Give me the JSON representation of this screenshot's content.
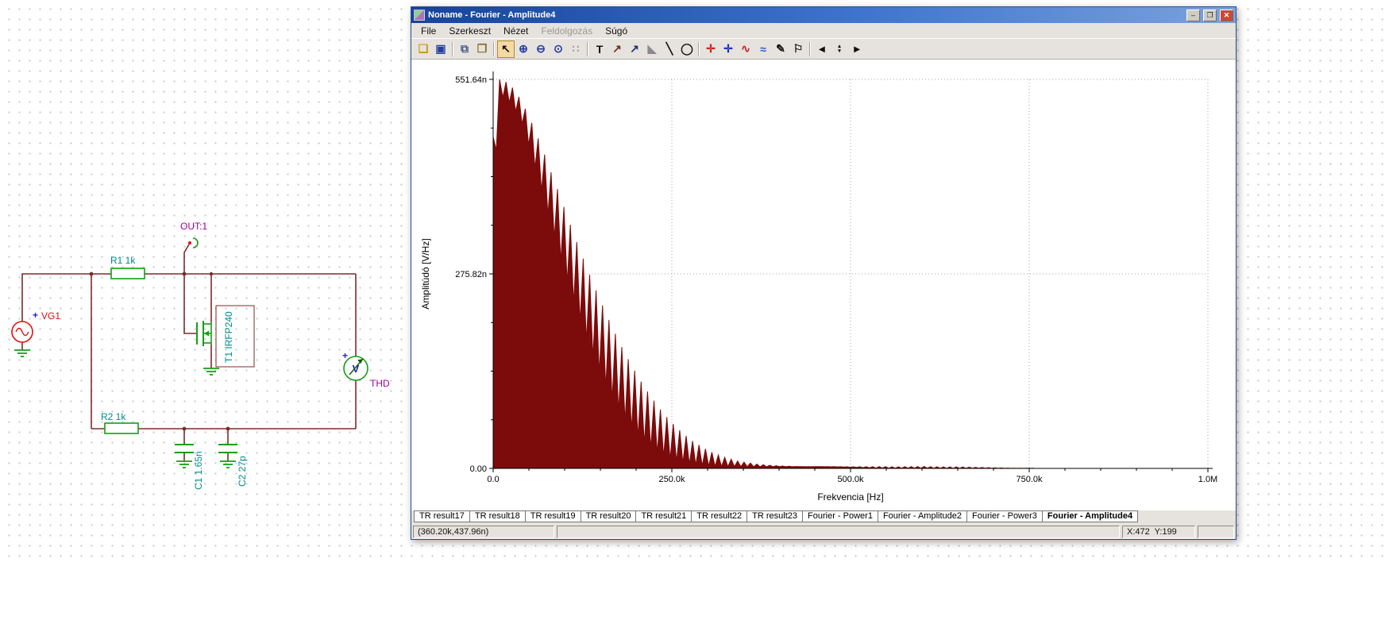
{
  "schematic": {
    "source_label": "VG1",
    "source_plus": "+",
    "r1_label": "R1 1k",
    "r2_label": "R2 1k",
    "out_label": "OUT:1",
    "mosfet_label": "T1 IRFP240",
    "c1_label": "C1 1.65n",
    "c2_label": "C2 27p",
    "meter_label": "THD",
    "meter_symbol": "V",
    "meter_plus": "+",
    "colors": {
      "wire": "#7b2b2b",
      "component": "#12a012",
      "value_label": "#008b8b",
      "net_label": "#a000a0",
      "source": "#e01010",
      "meter_text": "#2424c8"
    }
  },
  "window": {
    "title": "Noname - Fourier - Amplitude4",
    "controls": {
      "minimize": "‒",
      "restore": "❐",
      "close": "✕"
    }
  },
  "menu": {
    "items": [
      {
        "label": "File",
        "enabled": true
      },
      {
        "label": "Szerkeszt",
        "enabled": true
      },
      {
        "label": "Nézet",
        "enabled": true
      },
      {
        "label": "Feldolgozás",
        "enabled": false
      },
      {
        "label": "Súgó",
        "enabled": true
      }
    ]
  },
  "toolbar": {
    "icons": [
      {
        "name": "open-icon",
        "glyph": "❑",
        "color": "#c79810"
      },
      {
        "name": "save-icon",
        "glyph": "▣",
        "color": "#24409c"
      },
      {
        "sep": true
      },
      {
        "name": "copy-icon",
        "glyph": "⧉",
        "color": "#445a8c"
      },
      {
        "name": "paste-icon",
        "glyph": "❒",
        "color": "#8c6a2a"
      },
      {
        "sep": true
      },
      {
        "name": "select-tool-icon",
        "glyph": "↖",
        "color": "#101010",
        "active": true
      },
      {
        "name": "zoom-in-icon",
        "glyph": "⊕",
        "color": "#283ca0"
      },
      {
        "name": "zoom-out-icon",
        "glyph": "⊖",
        "color": "#283ca0"
      },
      {
        "name": "zoom-100-icon",
        "glyph": "⊙",
        "color": "#283ca0"
      },
      {
        "name": "grid-icon",
        "glyph": "∷",
        "color": "#9a9a9a"
      },
      {
        "sep": true
      },
      {
        "name": "text-tool-icon",
        "glyph": "T",
        "color": "#101010"
      },
      {
        "name": "cursor-a-tool-icon",
        "glyph": "↗",
        "color": "#70301c"
      },
      {
        "name": "cursor-b-tool-icon",
        "glyph": "↗",
        "color": "#1c3070"
      },
      {
        "name": "ruler-tool-icon",
        "glyph": "◣",
        "color": "#8a8a8a"
      },
      {
        "name": "line-tool-icon",
        "glyph": "╲",
        "color": "#101010"
      },
      {
        "name": "ellipse-tool-icon",
        "glyph": "◯",
        "color": "#101010"
      },
      {
        "sep": true
      },
      {
        "name": "axes-red-icon",
        "glyph": "✛",
        "color": "#d02020"
      },
      {
        "name": "axes-blue-icon",
        "glyph": "✛",
        "color": "#2030c0"
      },
      {
        "name": "add-curve-icon",
        "glyph": "∿",
        "color": "#d02020"
      },
      {
        "name": "curves-icon",
        "glyph": "≈",
        "color": "#2858c8"
      },
      {
        "name": "pen-tool-icon",
        "glyph": "✎",
        "color": "#101010"
      },
      {
        "name": "flag-tool-icon",
        "glyph": "⚐",
        "color": "#101010"
      },
      {
        "sep": true
      },
      {
        "name": "prev-page-icon",
        "glyph": "◂",
        "color": "#101010"
      },
      {
        "name": "page-spinner-icon",
        "glyph": "▴▾",
        "color": "#101010",
        "stacked": true
      },
      {
        "name": "next-page-icon",
        "glyph": "▸",
        "color": "#101010"
      }
    ]
  },
  "chart_data": {
    "type": "area",
    "title": "",
    "xlabel": "Frekvencia [Hz]",
    "ylabel": "Amplitúdó [V/Hz]",
    "xlim_hz": [
      0,
      1000000
    ],
    "ylim": [
      "0",
      "551.64n"
    ],
    "grid": true,
    "fill_color": "#7c0b0b",
    "x_ticks": [
      {
        "pos_khz": 0,
        "label": "0.0"
      },
      {
        "pos_khz": 250,
        "label": "250.0k"
      },
      {
        "pos_khz": 500,
        "label": "500.0k"
      },
      {
        "pos_khz": 750,
        "label": "750.0k"
      },
      {
        "pos_khz": 1000,
        "label": "1.0M"
      }
    ],
    "y_ticks": [
      {
        "value_n": 551.64,
        "label": "551.64n"
      },
      {
        "value_n": 275.82,
        "label": "275.82n"
      },
      {
        "value_n": 0,
        "label": "0.00"
      }
    ],
    "harmonic_spacing_khz": 9,
    "valley_stretch": 1.35,
    "envelope_f_khz": [
      0,
      4,
      9,
      18,
      27,
      36,
      45,
      54,
      63,
      72,
      81,
      90,
      100,
      110,
      120,
      130,
      140,
      150,
      160,
      170,
      180,
      190,
      200,
      210,
      220,
      230,
      240,
      250,
      260,
      270,
      280,
      290,
      300,
      310,
      320,
      330,
      340,
      350,
      360,
      370,
      380,
      390,
      400,
      420,
      440,
      460,
      480,
      500,
      520,
      540,
      560,
      580,
      600,
      620,
      640,
      660,
      680,
      700,
      720,
      750,
      1000
    ],
    "envelope_amp_n": [
      470,
      540,
      551.64,
      548,
      540,
      527,
      510,
      490,
      468,
      445,
      420,
      396,
      368,
      340,
      313,
      287,
      262,
      238,
      215,
      193,
      172,
      153,
      135,
      118,
      103,
      89,
      76,
      65,
      55,
      46,
      38,
      32,
      26,
      21,
      17,
      14,
      11,
      9,
      7.5,
      6,
      5,
      4.2,
      3.5,
      2.8,
      2.5,
      2.6,
      2.4,
      2.2,
      2.4,
      2.6,
      2.3,
      2.5,
      2.7,
      2.4,
      2.2,
      2.0,
      1.5,
      1.0,
      0.4,
      0.2,
      0.1
    ]
  },
  "tabs": {
    "items": [
      "TR result17",
      "TR result18",
      "TR result19",
      "TR result20",
      "TR result21",
      "TR result22",
      "TR result23",
      "Fourier - Power1",
      "Fourier - Amplitude2",
      "Fourier - Power3",
      "Fourier - Amplitude4"
    ],
    "active": "Fourier - Amplitude4"
  },
  "statusbar": {
    "cursor_value": "(360.20k,437.96n)",
    "pixel_coords": "X:472  Y:199"
  }
}
